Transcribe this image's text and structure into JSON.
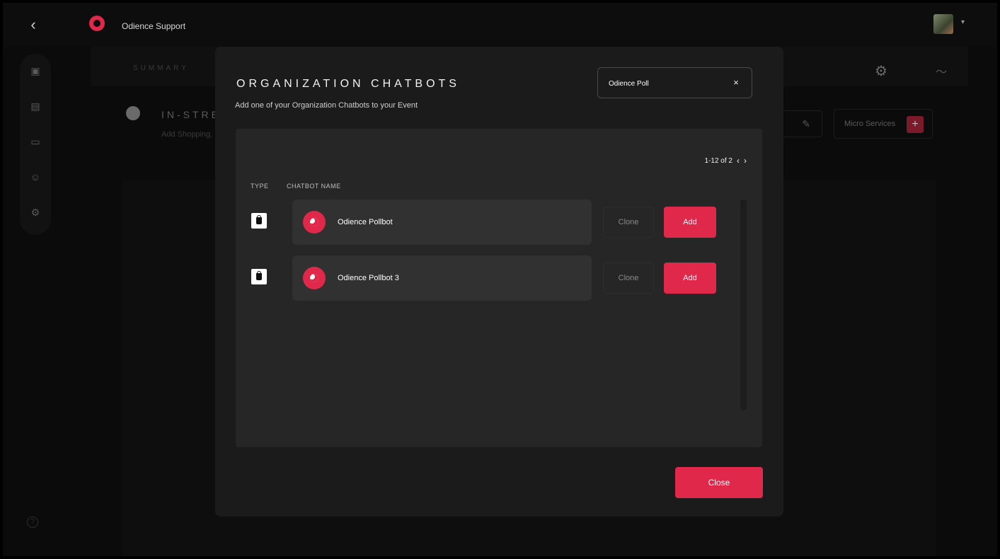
{
  "app": {
    "title": "Odience Support",
    "back_icon": "chevron-left-icon",
    "brand_color": "#e0294a"
  },
  "background": {
    "tab_summary": "SUMMARY",
    "section_title": "IN-STRE",
    "section_subtitle": "Add Shopping,",
    "micro_services_label": "Micro Services",
    "micro_services_plus": "+"
  },
  "modal": {
    "title": "ORGANIZATION CHATBOTS",
    "subtitle": "Add one of your Organization Chatbots to your Event",
    "search": {
      "value": "Odience Poll",
      "clear_label": "×"
    },
    "pagination": {
      "range": "1-12 of 2",
      "prev": "‹",
      "next": "›"
    },
    "columns": {
      "type": "TYPE",
      "name": "CHATBOT NAME"
    },
    "rows": [
      {
        "name": "Odience Pollbot",
        "clone_label": "Clone",
        "add_label": "Add"
      },
      {
        "name": "Odience Pollbot 3",
        "clone_label": "Clone",
        "add_label": "Add"
      }
    ],
    "close_label": "Close"
  },
  "help_icon": "?"
}
